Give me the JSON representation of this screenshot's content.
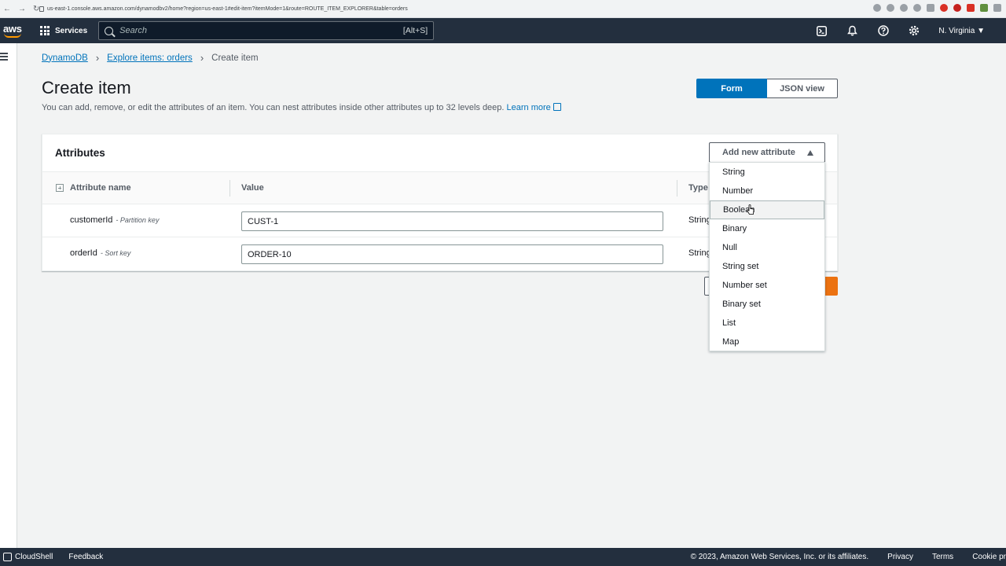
{
  "browser": {
    "url": "us-east-1.console.aws.amazon.com/dynamodbv2/home?region=us-east-1#edit-item?itemMode=1&route=ROUTE_ITEM_EXPLORER&table=orders"
  },
  "topnav": {
    "logo": "aws",
    "services_label": "Services",
    "search_placeholder": "Search",
    "search_shortcut": "[Alt+S]",
    "region": "N. Virginia ▼",
    "icons": [
      "cloudshell-icon",
      "bell-icon",
      "help-icon",
      "gear-icon"
    ]
  },
  "breadcrumb": {
    "items": [
      "DynamoDB",
      "Explore items: orders"
    ],
    "current": "Create item"
  },
  "page": {
    "title": "Create item",
    "description": "You can add, remove, or edit the attributes of an item. You can nest attributes inside other attributes up to 32 levels deep.",
    "learn_more": "Learn more"
  },
  "view_toggle": {
    "form": "Form",
    "json": "JSON view",
    "active": "Form"
  },
  "attributes": {
    "title": "Attributes",
    "columns": {
      "name": "Attribute name",
      "value": "Value",
      "type": "Type"
    },
    "rows": [
      {
        "name": "customerId",
        "key_label": "- Partition key",
        "value": "CUST-1",
        "type": "String"
      },
      {
        "name": "orderId",
        "key_label": "- Sort key",
        "value": "ORDER-10",
        "type": "String"
      }
    ]
  },
  "add_attribute": {
    "label": "Add new attribute",
    "options": [
      "String",
      "Number",
      "Boolean",
      "Binary",
      "Null",
      "String set",
      "Number set",
      "Binary set",
      "List",
      "Map"
    ],
    "hovered": "Boolean"
  },
  "colors": {
    "nav_bg": "#232f3e",
    "accent_blue": "#0073bb",
    "accent_orange": "#ec7211",
    "page_bg": "#f2f3f3"
  },
  "footer": {
    "cloudshell": "CloudShell",
    "feedback": "Feedback",
    "copyright": "© 2023, Amazon Web Services, Inc. or its affiliates.",
    "links": [
      "Privacy",
      "Terms",
      "Cookie pr"
    ]
  }
}
